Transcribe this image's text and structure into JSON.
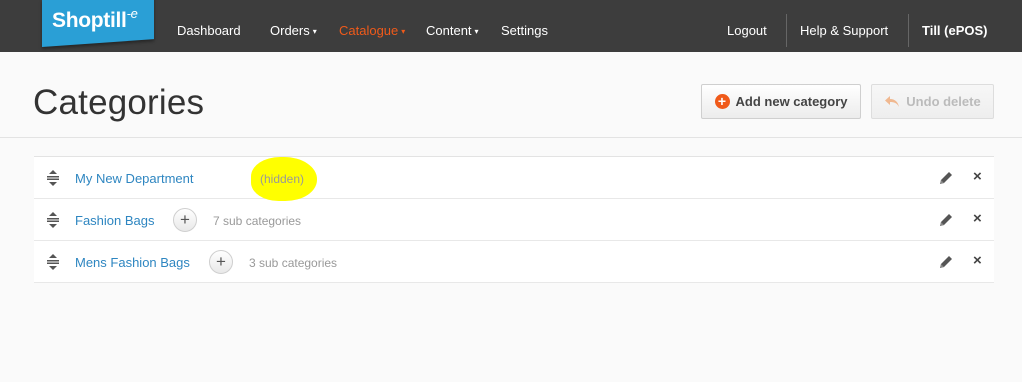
{
  "app": {
    "logo_text": "Shoptill",
    "logo_suffix": "-e"
  },
  "nav": {
    "items": [
      {
        "label": "Dashboard",
        "dropdown": false,
        "active": false
      },
      {
        "label": "Orders",
        "dropdown": true,
        "active": false
      },
      {
        "label": "Catalogue",
        "dropdown": true,
        "active": true
      },
      {
        "label": "Content",
        "dropdown": true,
        "active": false
      },
      {
        "label": "Settings",
        "dropdown": false,
        "active": false
      }
    ],
    "right": {
      "logout": "Logout",
      "help": "Help & Support",
      "account": "Till (ePOS)"
    },
    "caret": "▾"
  },
  "page": {
    "title": "Categories",
    "add_button": "Add new category",
    "undo_button": "Undo delete"
  },
  "categories": [
    {
      "name": "My New Department",
      "status": "(hidden)",
      "sub_count": ""
    },
    {
      "name": "Fashion Bags",
      "status": "",
      "sub_count": "7 sub categories"
    },
    {
      "name": "Mens Fashion Bags",
      "status": "",
      "sub_count": "3 sub categories"
    }
  ],
  "icons": {
    "expand": "+",
    "delete": "×"
  },
  "colors": {
    "topbar": "#3d3d3d",
    "accent": "#f05a1a",
    "logo": "#2a9fd6",
    "link": "#2e86c1",
    "highlight": "#ffff00"
  }
}
